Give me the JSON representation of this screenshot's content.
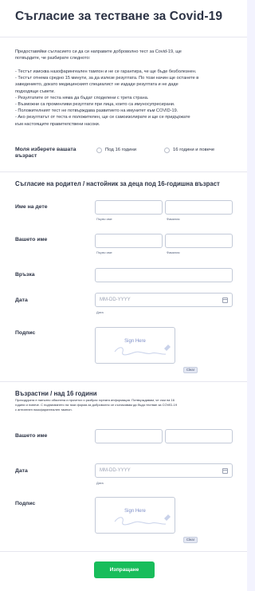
{
  "form": {
    "title": "Съгласие за тестване за Covid-19",
    "intro": {
      "line1": "Предоставяйки съгласието си да си направите доброволно тест за Covid-19, ще",
      "line2": "потвърдите, че разбирате следното:",
      "bullets": [
        "- Тестът изисква назофарингеален тампон и не се гарантира, че ще бъде безболезнен.",
        "- Тестът отнема средно 15 минути, за да излезе резултата. По този начин ще останете в",
        "заведението, докато медицинският специалист не издаде резултата и не даде",
        "подходящи съвети.",
        "- Резултатите от теста няма да бъдат споделени с трета страна.",
        "- Възможни са променливи резултати при лица, които са имуносупресирани.",
        "- Положителният тест не потвърждава развитието на имунитет към COVID-19.",
        "- Ако резултатът от теста е положителен, ще се самоизолирате и ще се придържате",
        "към настоящите правителствени насоки."
      ]
    },
    "age_question": {
      "label_line1": "Моля изберете вашата",
      "label_line2": "възраст",
      "options": [
        "Под 16 години",
        "16 години и повече"
      ]
    },
    "parent_section": {
      "title": "Съгласие на родител / настойник за деца под 16-годишна възраст",
      "child_name_label": "Име на дете",
      "your_name_label": "Вашето име",
      "first_name_sub": "Първо име",
      "last_name_sub": "Фамилия",
      "relation_label": "Връзка",
      "date_label": "Дата",
      "date_placeholder": "MM-DD-YYYY",
      "date_sub": "Дата",
      "signature_label": "Подпис",
      "signature_placeholder": "Sign Here",
      "clear_label": "Clear"
    },
    "adult_section": {
      "title": "Възрастни / над 16 години",
      "desc_line1": "Прочидурата е напълно обяснена и прочетох и разбрах горната информация. Потвърждавам, че съм на 16",
      "desc_line2": "години и повече. С подписването на тази форма аз доброволно се съгласявам да бъда тестван за COVID-19",
      "desc_line3": "с антигенен назофарингеален тампон.",
      "your_name_label": "Вашето име",
      "date_label": "Дата",
      "date_placeholder": "MM-DD-YYYY",
      "date_sub": "Дата",
      "signature_label": "Подпис",
      "signature_placeholder": "Sign Here",
      "clear_label": "Clear"
    },
    "submit_label": "Изпращане"
  },
  "colors": {
    "accent_green": "#18bd5b",
    "text_dark": "#2c3345",
    "border": "#c3cad8"
  }
}
